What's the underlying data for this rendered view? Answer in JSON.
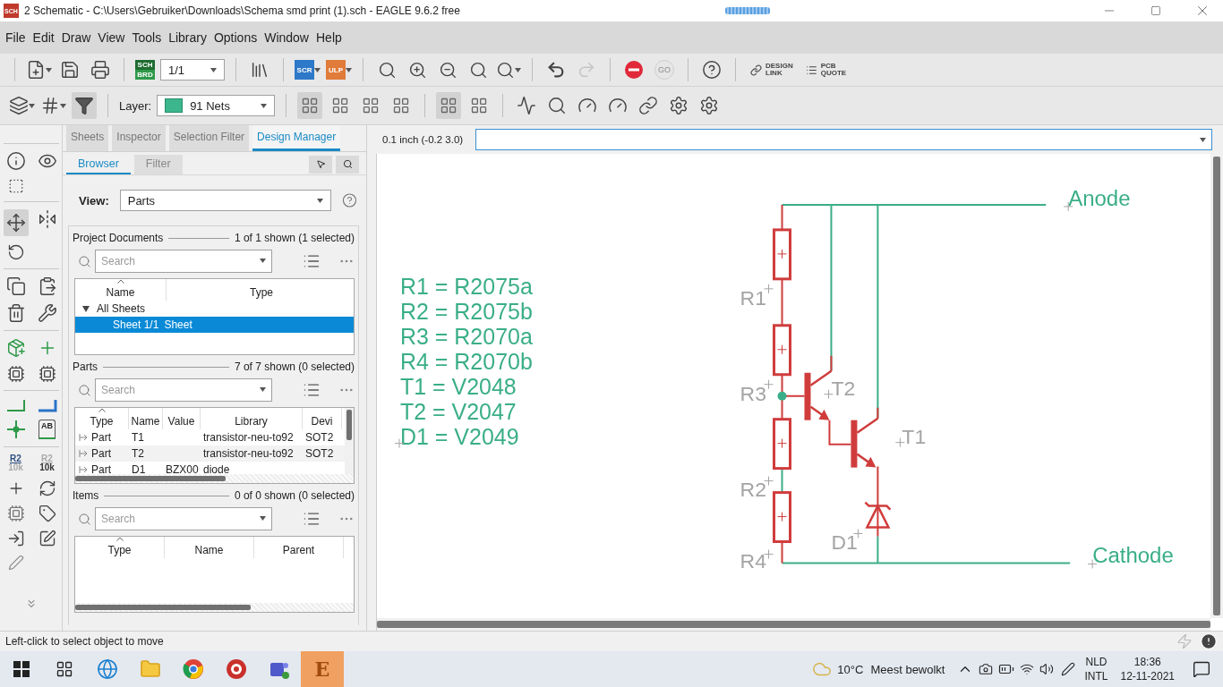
{
  "window": {
    "app_icon_text": "SCH",
    "title": "2 Schematic - C:\\Users\\Gebruiker\\Downloads\\Schema smd print (1).sch - EAGLE 9.6.2 free"
  },
  "menu": [
    "File",
    "Edit",
    "Draw",
    "View",
    "Tools",
    "Library",
    "Options",
    "Window",
    "Help"
  ],
  "toolbar": {
    "sch_brd": [
      "SCH",
      "BRD"
    ],
    "schematic_active": true,
    "sheet": "1/1",
    "scr": "SCR",
    "ulp": "ULP",
    "go": {
      "label": "GO",
      "disabled": true
    },
    "design_link": [
      "DESIGN",
      "LINK"
    ],
    "pcb_quote": [
      "PCB",
      "QUOTE"
    ]
  },
  "layer_bar": {
    "label": "Layer:",
    "layer": "91 Nets"
  },
  "left_tools": {
    "label_tool": "AB",
    "name_tool": [
      "R2",
      "10k"
    ],
    "value_tool": [
      "R2",
      "10k"
    ]
  },
  "panel": {
    "tabs": [
      {
        "label": "Sheets",
        "selected": false
      },
      {
        "label": "Inspector",
        "selected": false
      },
      {
        "label": "Selection Filter",
        "selected": false
      },
      {
        "label": "Design Manager",
        "selected": true
      }
    ],
    "subtabs": [
      {
        "label": "Browser",
        "selected": true
      },
      {
        "label": "Filter",
        "selected": false
      }
    ],
    "view": {
      "label": "View:",
      "value": "Parts"
    },
    "sections": [
      {
        "kind": "tree",
        "title": "Project Documents",
        "count": "1 of 1 shown (1 selected)",
        "placeholder": "Search",
        "columns": [
          "Name",
          "Type"
        ],
        "tree": [
          {
            "name": "All Sheets",
            "expanded": true,
            "children": [
              {
                "name": "Sheet 1/1",
                "type": "Sheet",
                "selected": true
              }
            ]
          }
        ]
      },
      {
        "kind": "table",
        "title": "Parts",
        "count": "7 of 7 shown (0 selected)",
        "placeholder": "Search",
        "columns": [
          "Type",
          "Name",
          "Value",
          "Library",
          "Devi"
        ],
        "rows": [
          {
            "type": "Part",
            "name": "T1",
            "library": "transistor-neu-to92",
            "device": "SOT2"
          },
          {
            "type": "Part",
            "name": "T2",
            "library": "transistor-neu-to92",
            "device": "SOT2"
          },
          {
            "type": "Part",
            "name": "D1",
            "value": "BZX00",
            "library": "diode"
          }
        ]
      },
      {
        "kind": "table",
        "title": "Items",
        "count": "0 of 0 shown (0 selected)",
        "placeholder": "Search",
        "columns": [
          "Type",
          "Name",
          "Parent"
        ]
      }
    ]
  },
  "canvas": {
    "coordinates": "0.1 inch (-0.2 3.0)"
  },
  "schematic": {
    "notes": [
      "R1 = R2075a",
      "R2 = R2075b",
      "R3 = R2070a",
      "R4 = R2070b",
      "T1 = V2048",
      "T2 = V2047",
      "D1 = V2049"
    ],
    "part_labels": [
      "R1",
      "R3",
      "R2",
      "R4",
      "T2",
      "T1",
      "D1"
    ],
    "net_labels": [
      "Anode",
      "Cathode"
    ]
  },
  "status_bar": "Left-click to select object to move",
  "taskbar": {
    "eagle_icon_text": "E",
    "temperature": "10°C",
    "weather": "Meest bewolkt",
    "language": [
      "NLD",
      "INTL"
    ],
    "time": "18:36",
    "date": "12-11-2021"
  }
}
